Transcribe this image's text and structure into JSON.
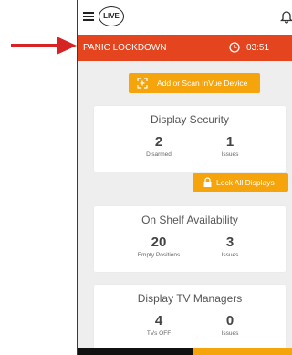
{
  "colors": {
    "alert": "#e5451e",
    "accent": "#f5a50b",
    "arrow": "#d62424",
    "background": "#eeeeee"
  },
  "header": {
    "logo_text": "LIVE",
    "menu_icon": "hamburger-icon",
    "notification_icon": "bell-icon"
  },
  "alert": {
    "label": "PANIC LOCKDOWN",
    "timer": "03:51",
    "timer_icon": "clock-icon"
  },
  "add_device_button": {
    "label": "Add or Scan InVue Device",
    "icon": "scan-icon"
  },
  "display_security": {
    "title": "Display Security",
    "stats": [
      {
        "value": "2",
        "label": "Disarmed"
      },
      {
        "value": "1",
        "label": "Issues"
      }
    ],
    "lock_button": {
      "label": "Lock All Displays",
      "icon": "lock-icon"
    }
  },
  "on_shelf": {
    "title": "On Shelf Availability",
    "stats": [
      {
        "value": "20",
        "label": "Empty Positions"
      },
      {
        "value": "3",
        "label": "Issues"
      }
    ]
  },
  "tv_managers": {
    "title": "Display TV Managers",
    "stats": [
      {
        "value": "4",
        "label": "TVs OFF"
      },
      {
        "value": "0",
        "label": "Issues"
      }
    ]
  }
}
